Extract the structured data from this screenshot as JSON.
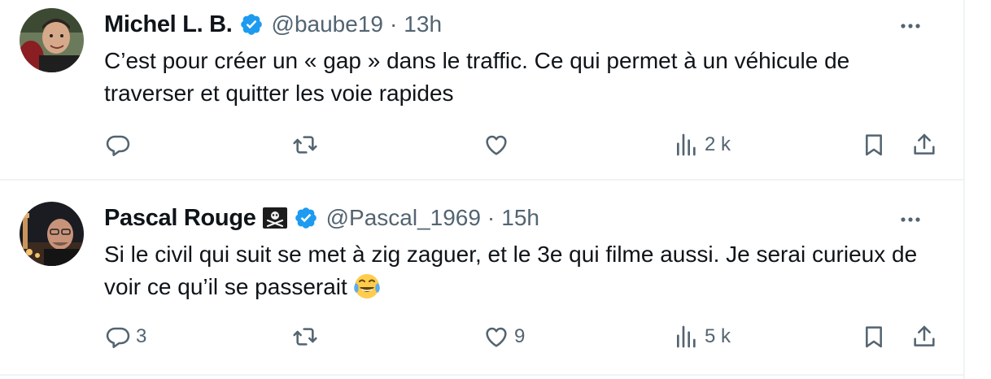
{
  "tweets": [
    {
      "name": "Michel L. B.",
      "handle": "@baube19",
      "separator": "·",
      "time": "13h",
      "text": "C’est pour créer un « gap » dans le traffic. Ce qui permet à un véhicule de traverser et quitter les voie rapides",
      "replies": "",
      "retweets": "",
      "likes": "",
      "views": "2 k"
    },
    {
      "name": "Pascal Rouge",
      "handle": "@Pascal_1969",
      "separator": "·",
      "time": "15h",
      "text": "Si le civil qui suit se met à zig zaguer, et le 3e qui filme aussi. Je serai curieux de voir ce qu’il se passerait",
      "replies": "3",
      "retweets": "",
      "likes": "9",
      "views": "5 k"
    }
  ],
  "colors": {
    "verified": "#1d9bf0",
    "secondary_text": "#536471",
    "divider": "#eff3f4"
  },
  "icons": [
    "verified-badge-icon",
    "pirate-flag-icon",
    "more-icon",
    "reply-icon",
    "retweet-icon",
    "like-icon",
    "views-icon",
    "bookmark-icon",
    "share-icon",
    "tears-of-joy-emoji"
  ]
}
